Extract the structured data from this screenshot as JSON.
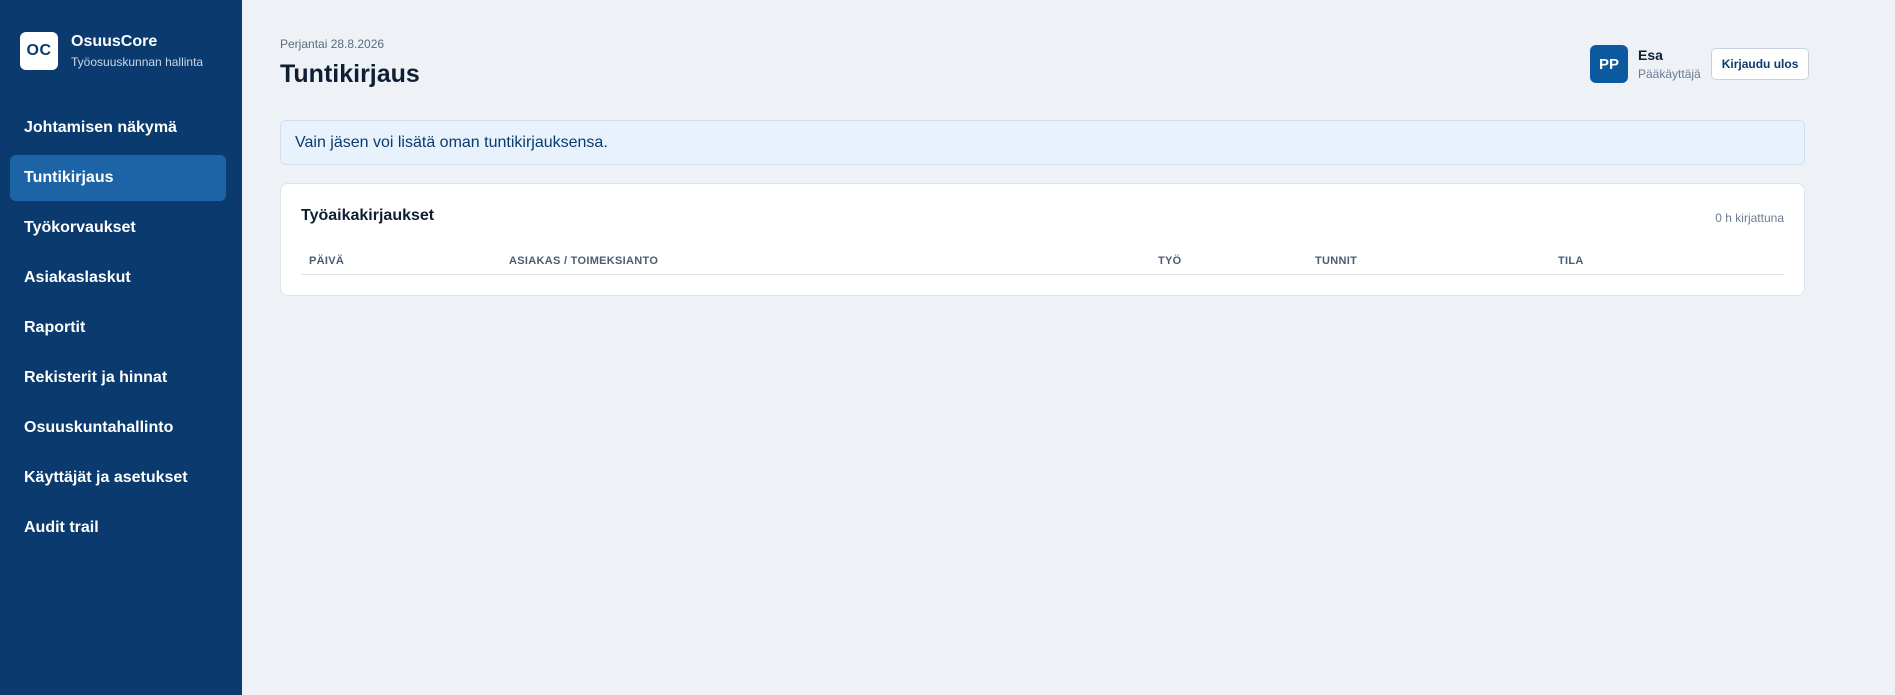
{
  "brand": {
    "logo": "OC",
    "name": "OsuusCore",
    "subtitle": "Työosuuskunnan hallinta"
  },
  "sidebar": {
    "items": [
      {
        "label": "Johtamisen näkymä",
        "active": false
      },
      {
        "label": "Tuntikirjaus",
        "active": true
      },
      {
        "label": "Työkorvaukset",
        "active": false
      },
      {
        "label": "Asiakaslaskut",
        "active": false
      },
      {
        "label": "Raportit",
        "active": false
      },
      {
        "label": "Rekisterit ja hinnat",
        "active": false
      },
      {
        "label": "Osuuskuntahallinto",
        "active": false
      },
      {
        "label": "Käyttäjät ja asetukset",
        "active": false
      },
      {
        "label": "Audit trail",
        "active": false
      }
    ]
  },
  "header": {
    "date": "Perjantai 28.8.2026",
    "title": "Tuntikirjaus"
  },
  "user": {
    "initials": "PP",
    "name": "Esa",
    "role": "Pääkäyttäjä",
    "logout_label": "Kirjaudu ulos"
  },
  "notice": {
    "text": "Vain jäsen voi lisätä oman tuntikirjauksensa."
  },
  "entries": {
    "title": "Työaikakirjaukset",
    "summary": "0 h kirjattuna",
    "columns": [
      "PÄIVÄ",
      "ASIAKAS / TOIMEKSIANTO",
      "TYÖ",
      "TUNNIT",
      "TILA"
    ],
    "rows": []
  },
  "colors": {
    "sidebar_bg": "#0b3a6e",
    "active_item": "#1d64a6",
    "page_bg": "#eef2f7",
    "notice_bg": "#e8f2fc"
  }
}
